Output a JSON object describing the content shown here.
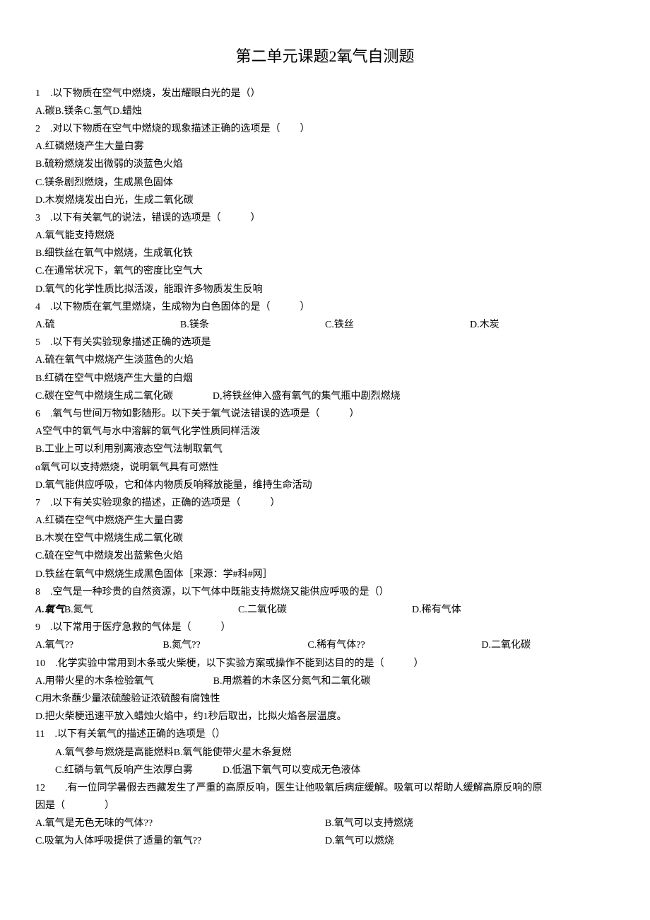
{
  "title": "第二单元课题2氧气自测题",
  "q1": {
    "stem": "1　.以下物质在空气中燃烧，发出耀眼白光的是（）",
    "opts": "A.碳B.镁条C.氢气D.蜡烛"
  },
  "q2": {
    "stem": "2　.对以下物质在空气中燃烧的现象描述正确的选项是（　　）",
    "a": "A.红磷燃烧产生大量白雾",
    "b": "B.硫粉燃烧发出微弱的淡蓝色火焰",
    "c": "C.镁条剧烈燃烧，生成黑色固体",
    "d": "D.木炭燃烧发出白光，生成二氧化碳"
  },
  "q3": {
    "stem": "3　.以下有关氧气的说法，错误的选项是（　　　）",
    "a": "A.氧气能支持燃烧",
    "b": "B.细铁丝在氧气中燃烧，生成氧化铁",
    "c": "C.在通常状况下，氧气的密度比空气大",
    "d": "D.氧气的化学性质比拟活泼，能跟许多物质发生反响"
  },
  "q4": {
    "stem": "4　.以下物质在氧气里燃烧，生成物为白色固体的是（　　　）",
    "a": "A.硫",
    "b": "B.镁条",
    "c": "C.铁丝",
    "d": "D.木炭"
  },
  "q5": {
    "stem": "5　.以下有关实验现象描述正确的选项是",
    "a": "A.硫在氧气中燃烧产生淡蓝色的火焰",
    "b": "B.红磷在空气中燃烧产生大量的白烟",
    "c": "C.碳在空气中燃烧生成二氧化碳　　　　D,将铁丝伸入盛有氧气的集气瓶中剧烈燃烧"
  },
  "q6": {
    "stem": "6　.氧气与世间万物如影随形。以下关于氧气说法错误的选项是（　　　）",
    "a": "A空气中的氧气与水中溶解的氧气化学性质同样活泼",
    "b": "B.工业上可以利用别离液态空气法制取氧气",
    "c": "α氧气可以支持燃烧，说明氧气具有可燃性",
    "d": "D.氧气能供应呼吸，它和体内物质反响释放能量，维持生命活动"
  },
  "q7": {
    "stem": "7　.以下有关实验现象的描述，正确的选项是（　　　）",
    "a": "A.红磷在空气中燃烧产生大量白雾",
    "b": "B.木炭在空气中燃烧生成二氧化碳",
    "c": "C.硫在空气中燃烧发出蓝紫色火焰",
    "d": "D.铁丝在氧气中燃烧生成黑色固体［来源：学#科#网］"
  },
  "q8": {
    "stem": "8　.空气是一种珍贵的自然资源，以下气体中既能支持燃烧又能供应呼吸的是（）",
    "a_prefix": "A.",
    "a_italic": "氧气",
    "b": "B.氮气",
    "c": "C.二氧化碳",
    "d": "D.稀有气体"
  },
  "q9": {
    "stem": "9　.以下常用于医疗急救的气体是（　　　）",
    "a": "A.氧气??",
    "b": "B.氮气??",
    "c": "C.稀有气体??",
    "d": "D.二氧化碳"
  },
  "q10": {
    "stem": "10　.化学实验中常用到木条或火柴梗，以下实验方案或操作不能到达目的的是（　　　）",
    "a": "A.用带火星的木条检验氧气　　　　　　B.用燃着的木条区分氮气和二氧化碳",
    "c": "C用木条蘸少量浓硫酸验证浓硫酸有腐蚀性",
    "d": "D.把火柴梗迅速平放入蜡烛火焰中，约1秒后取出，比拟火焰各层温度。"
  },
  "q11": {
    "stem": "11　.以下有关氧气的描述正确的选项是（）",
    "ab": "A.氧气参与燃烧是高能燃料B.氧气能使带火星木条复燃",
    "cd": "C.红磷与氧气反响产生浓厚白雾　　　D.低温下氧气可以变成无色液体"
  },
  "q12": {
    "stem": "12　　.有一位同学暑假去西藏发生了严重的高原反响，医生让他吸氧后病症缓解。吸氧可以帮助人缓解高原反响的原",
    "stem2": "因是（　　　　）",
    "a": "A.氧气是无色无味的气体??",
    "b": "B.氧气可以支持燃烧",
    "c": "C.吸氧为人体呼吸提供了适量的氧气??",
    "d": "D.氧气可以燃烧"
  }
}
